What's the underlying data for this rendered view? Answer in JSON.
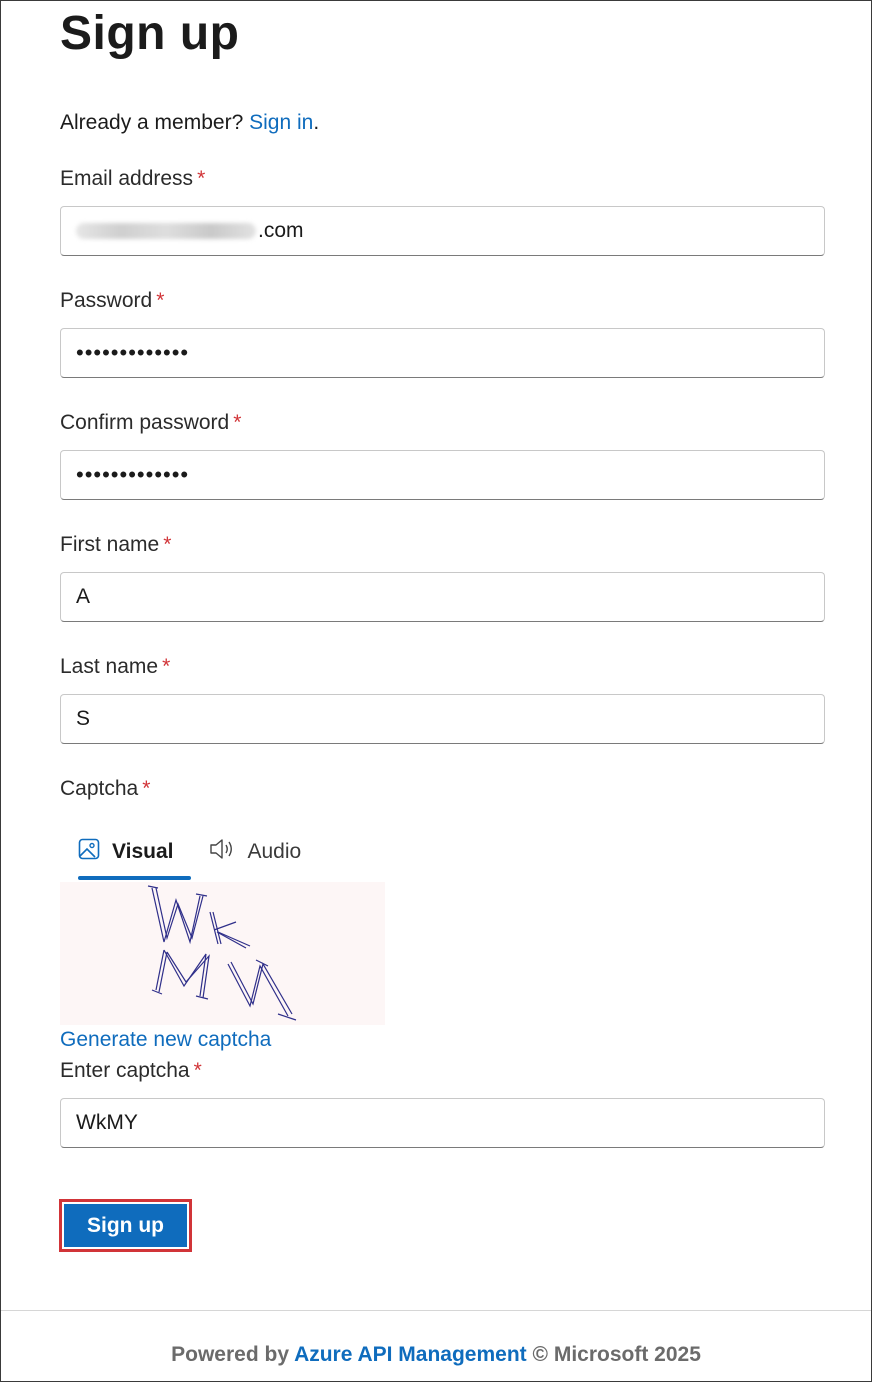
{
  "page": {
    "title": "Sign up",
    "member_prompt": "Already a member?",
    "sign_in_link": "Sign in",
    "member_suffix": "."
  },
  "form": {
    "required_mark": "*",
    "email": {
      "label": "Email address",
      "value_visible_suffix": ".com"
    },
    "password": {
      "label": "Password",
      "value_masked": "•••••••••••••"
    },
    "confirm_password": {
      "label": "Confirm password",
      "value_masked": "•••••••••••••"
    },
    "first_name": {
      "label": "First name",
      "value": "A"
    },
    "last_name": {
      "label": "Last name",
      "value": "S"
    },
    "captcha": {
      "label": "Captcha",
      "tabs": [
        {
          "label": "Visual",
          "icon": "image-icon",
          "active": true
        },
        {
          "label": "Audio",
          "icon": "speaker-icon",
          "active": false
        }
      ],
      "image_text": "WkMY",
      "generate_link": "Generate new captcha",
      "enter_label": "Enter captcha",
      "enter_value": "WkMY"
    },
    "submit_label": "Sign up"
  },
  "footer": {
    "prefix": "Powered by",
    "link": "Azure API Management",
    "suffix": "© Microsoft 2025"
  },
  "colors": {
    "accent": "#0f6cbd",
    "required": "#d13438",
    "highlight_border": "#d13438"
  }
}
